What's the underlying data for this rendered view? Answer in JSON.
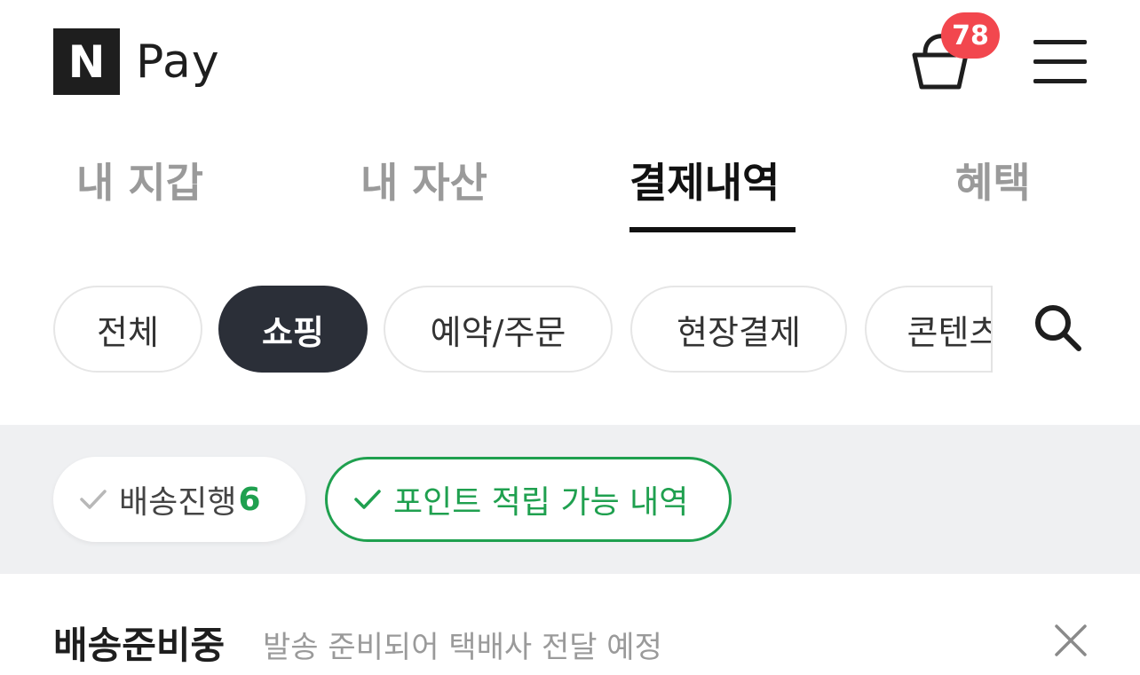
{
  "header": {
    "logo_mark": "N",
    "logo_text": "Pay",
    "cart_count": "78"
  },
  "tabs": [
    {
      "label": "내 지갑",
      "active": false
    },
    {
      "label": "내 자산",
      "active": false
    },
    {
      "label": "결제내역",
      "active": true
    },
    {
      "label": "혜택",
      "active": false
    }
  ],
  "categories": [
    {
      "label": "전체",
      "active": false
    },
    {
      "label": "쇼핑",
      "active": true
    },
    {
      "label": "예약/주문",
      "active": false
    },
    {
      "label": "현장결제",
      "active": false
    },
    {
      "label": "콘텐츠",
      "active": false
    }
  ],
  "filters": {
    "shipping_label": "배송진행",
    "shipping_count": "6",
    "points_label": "포인트 적립 가능 내역"
  },
  "status": {
    "title": "배송준비중",
    "description": "발송 준비되어 택배사 전달 예정"
  },
  "colors": {
    "accent_green": "#1fa04f",
    "badge_red": "#f2474e",
    "active_chip": "#2b2f38"
  },
  "icons": {
    "cart": "shopping-basket-icon",
    "menu": "hamburger-menu-icon",
    "search": "search-icon",
    "check": "check-icon",
    "close": "close-icon"
  }
}
